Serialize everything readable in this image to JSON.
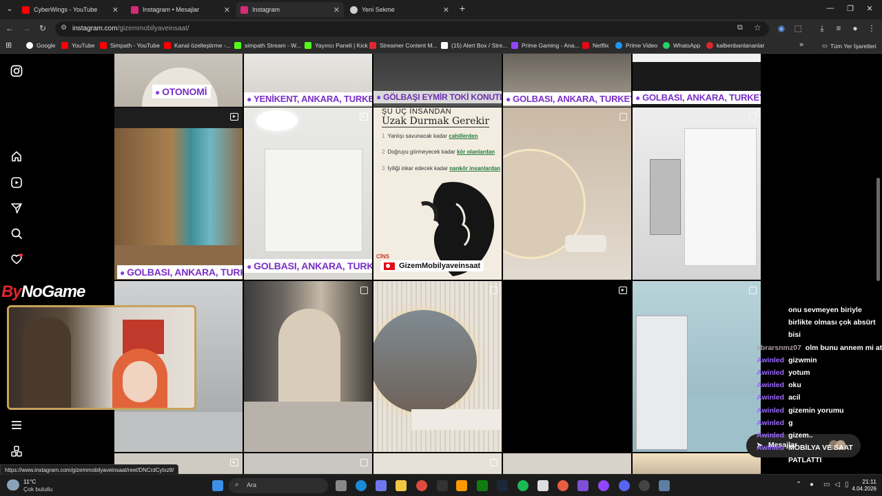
{
  "tabs": [
    {
      "label": "CyberWings - YouTube",
      "color": "#ff0000"
    },
    {
      "label": "Instagram • Mesajlar",
      "color": "#d62976"
    },
    {
      "label": "Instagram",
      "color": "#d62976"
    },
    {
      "label": "Yeni Sekme",
      "color": "#cfcfcf"
    }
  ],
  "address": {
    "domain": "instagram.com",
    "path": "/gizemmobilyaveinsaat/"
  },
  "bookmarks": [
    {
      "label": "Google",
      "color": "#ffffff"
    },
    {
      "label": "YouTube",
      "color": "#ff0000"
    },
    {
      "label": "Simpath - YouTube",
      "color": "#ff0000"
    },
    {
      "label": "Kanal özelleştirme -...",
      "color": "#ff0000"
    },
    {
      "label": "simpath Stream - W...",
      "color": "#53fc18"
    },
    {
      "label": "Yayıncı Paneli | Kick",
      "color": "#53fc18"
    },
    {
      "label": "Streamer Content M...",
      "color": "#e1262d"
    },
    {
      "label": "(15) Alert Box / Stre...",
      "color": "#ffffff"
    },
    {
      "label": "Prime Gaming - Ana...",
      "color": "#9146ff"
    },
    {
      "label": "Netflix",
      "color": "#e50914"
    },
    {
      "label": "Prime Video",
      "color": "#1a98ff"
    },
    {
      "label": "WhatsApp",
      "color": "#25d366"
    },
    {
      "label": "kalbenbanlananlar",
      "color": "#e1262d"
    }
  ],
  "bookmarks_other": "Tüm Yer İşaretleri",
  "grid": {
    "row1_locations": [
      "OTONOMİ",
      "YENİKENT, ANKARA, TURKEY",
      "GÖLBAŞI EYMİR TOKİ KONUTLARI",
      "GOLBASI, ANKARA, TURKEY",
      "GOLBASI, ANKARA, TURKEY"
    ],
    "row2_locations": [
      "GOLBASI, ANKARA, TURKEY",
      "GOLBASI, ANKARA, TURKEY"
    ],
    "quote": {
      "small": "ŞU ÜÇ İNSANDAN",
      "big": "Uzak Durmak Gerekir",
      "lines": [
        {
          "n": "1",
          "text": "Yanlışı savunacak kadar ",
          "bold": "cahillerden"
        },
        {
          "n": "2",
          "text": "Doğruyu görmeyecek kadar ",
          "bold": "kör olanlardan"
        },
        {
          "n": "3",
          "text": "İyiliği inkar edecek kadar ",
          "bold": "nankör insanlardan"
        }
      ],
      "badge": "GizemMobilyaveinsaat",
      "corner": "CİNS"
    }
  },
  "overlay": {
    "logo_a": "By",
    "logo_b": "NoGame"
  },
  "chat": [
    {
      "user": "",
      "text": "onu sevmeyen biriyle"
    },
    {
      "user": "",
      "text": "birlikte olması çok absürt"
    },
    {
      "user": "",
      "text": "bisi"
    },
    {
      "user": "ebrarsnmz07",
      "text": "olm bunu annem mi attı"
    },
    {
      "user": "Awinled",
      "text": "gizwmin"
    },
    {
      "user": "Awinled",
      "text": "yotum"
    },
    {
      "user": "Awinled",
      "text": "oku"
    },
    {
      "user": "Awinled",
      "text": "acil"
    },
    {
      "user": "Awinled",
      "text": "gizemin yorumu"
    },
    {
      "user": "Awinled",
      "text": "g"
    },
    {
      "user": "Awinled",
      "text": "gizem.."
    },
    {
      "user": "Awinled",
      "text": "MOBİLYA VE SAAT"
    },
    {
      "user": "",
      "text": "PATLATTI"
    }
  ],
  "messages_pill": "Mesajlar",
  "status_url": "https://www.instagram.com/gizemmobilyaveinsaat/reel/DNCrdCytxz8/",
  "taskbar": {
    "weather_temp": "11°C",
    "weather_desc": "Çok bulutlu",
    "search": "Ara",
    "time": "21:11",
    "date": "4.04.2026"
  }
}
